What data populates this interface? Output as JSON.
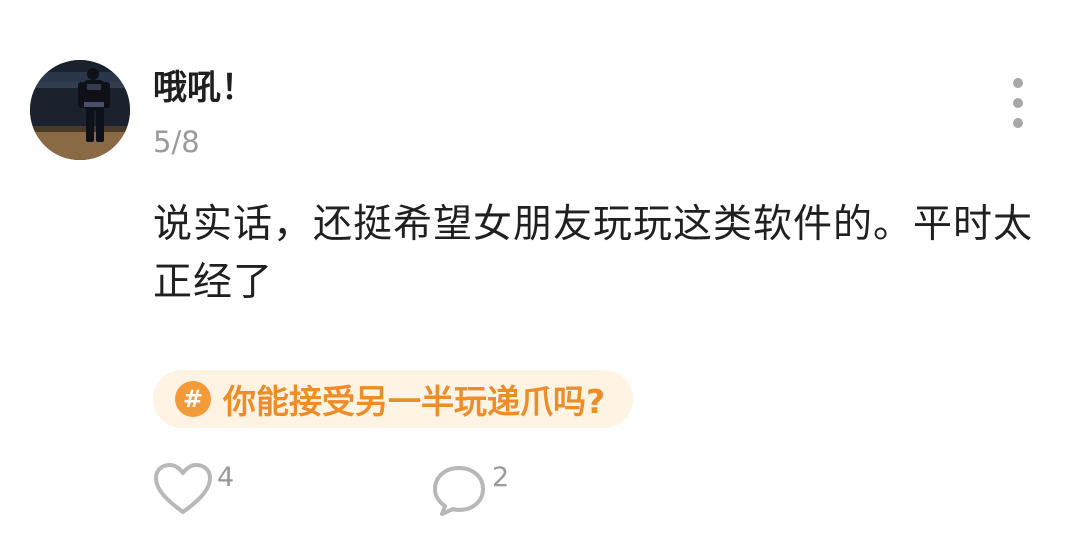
{
  "post": {
    "author": {
      "name": "哦吼！",
      "avatar_icon": "basketball-player-avatar"
    },
    "date": "5/8",
    "content": "说实话，还挺希望女朋友玩玩这类软件的。平时太正经了",
    "topic": {
      "icon": "hash-icon",
      "symbol": "#",
      "label": "你能接受另一半玩递爪吗?",
      "color": "#ec8d2a",
      "background": "#fff4e4"
    },
    "actions": {
      "like": {
        "icon": "heart-icon",
        "count": "4"
      },
      "comment": {
        "icon": "comment-bubble-icon",
        "count": "2"
      }
    },
    "menu": {
      "icon": "more-vertical-icon"
    }
  }
}
